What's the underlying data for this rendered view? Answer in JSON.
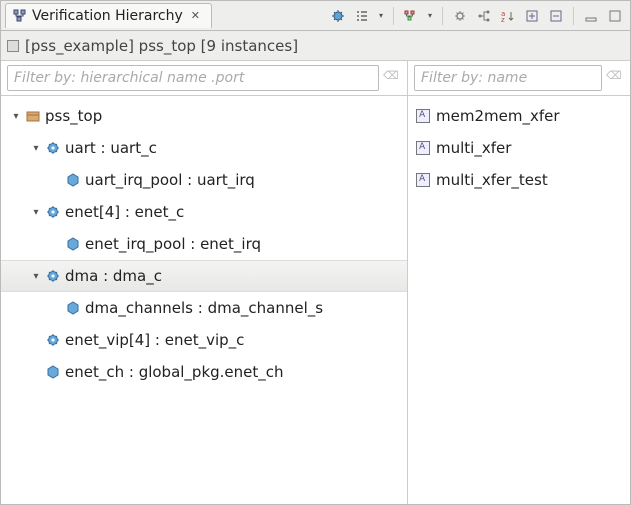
{
  "tab": {
    "title": "Verification Hierarchy"
  },
  "breadcrumb": {
    "text": "[pss_example] pss_top [9 instances]"
  },
  "filters": {
    "left_placeholder": "Filter by: hierarchical name .port",
    "right_placeholder": "Filter by: name"
  },
  "tree": [
    {
      "depth": 0,
      "expander": "expanded",
      "icon": "package",
      "label": "pss_top",
      "selected": false
    },
    {
      "depth": 1,
      "expander": "expanded",
      "icon": "gear",
      "label": "uart : uart_c",
      "selected": false
    },
    {
      "depth": 2,
      "expander": "none",
      "icon": "hex",
      "label": "uart_irq_pool : uart_irq",
      "selected": false
    },
    {
      "depth": 1,
      "expander": "expanded",
      "icon": "gear",
      "label": "enet[4] : enet_c",
      "selected": false
    },
    {
      "depth": 2,
      "expander": "none",
      "icon": "hex",
      "label": "enet_irq_pool : enet_irq",
      "selected": false
    },
    {
      "depth": 1,
      "expander": "expanded",
      "icon": "gear",
      "label": "dma : dma_c",
      "selected": true
    },
    {
      "depth": 2,
      "expander": "none",
      "icon": "hex",
      "label": "dma_channels : dma_channel_s",
      "selected": false
    },
    {
      "depth": 1,
      "expander": "none",
      "icon": "gear",
      "label": "enet_vip[4] : enet_vip_c",
      "selected": false
    },
    {
      "depth": 1,
      "expander": "none",
      "icon": "hex",
      "label": "enet_ch : global_pkg.enet_ch",
      "selected": false
    }
  ],
  "list": [
    {
      "label": "mem2mem_xfer"
    },
    {
      "label": "multi_xfer"
    },
    {
      "label": "multi_xfer_test"
    }
  ]
}
